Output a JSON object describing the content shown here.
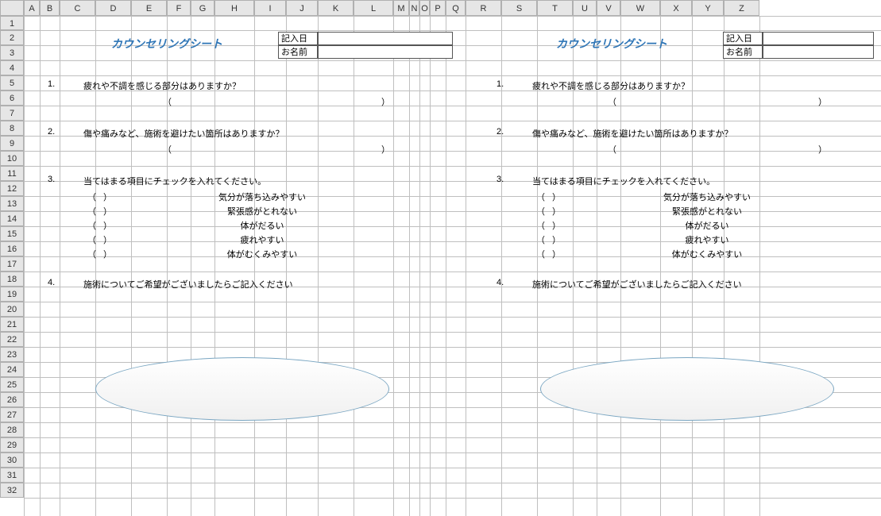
{
  "columns": [
    "A",
    "B",
    "C",
    "D",
    "E",
    "F",
    "G",
    "H",
    "I",
    "J",
    "K",
    "L",
    "M",
    "N",
    "O",
    "P",
    "Q",
    "R",
    "S",
    "T",
    "U",
    "V",
    "W",
    "X",
    "Y",
    "Z"
  ],
  "rows": [
    "1",
    "2",
    "3",
    "4",
    "5",
    "6",
    "7",
    "8",
    "9",
    "10",
    "11",
    "12",
    "13",
    "14",
    "15",
    "16",
    "17",
    "18",
    "19",
    "20",
    "21",
    "22",
    "23",
    "24",
    "25",
    "26",
    "27",
    "28",
    "29",
    "30",
    "31",
    "32"
  ],
  "title": "カウンセリングシート",
  "hdr_date": "記入日",
  "hdr_name": "お名前",
  "q1_num": "1.",
  "q1": "疲れや不調を感じる部分はありますか？",
  "q2_num": "2.",
  "q2": "傷や痛みなど、施術を避けたい箇所はありますか？",
  "q3_num": "3.",
  "q3": "当てはまる項目にチェックを入れてください。",
  "q4_num": "4.",
  "q4": "施術についてご希望がございましたらご記入ください",
  "paren_l": "（",
  "paren_r": "）",
  "chk1": "気分が落ち込みやすい",
  "chk2": "緊張感がとれない",
  "chk3": "体がだるい",
  "chk4": "疲れやすい",
  "chk5": "体がむくみやすい",
  "chk_l": "（",
  "chk_r": "）"
}
